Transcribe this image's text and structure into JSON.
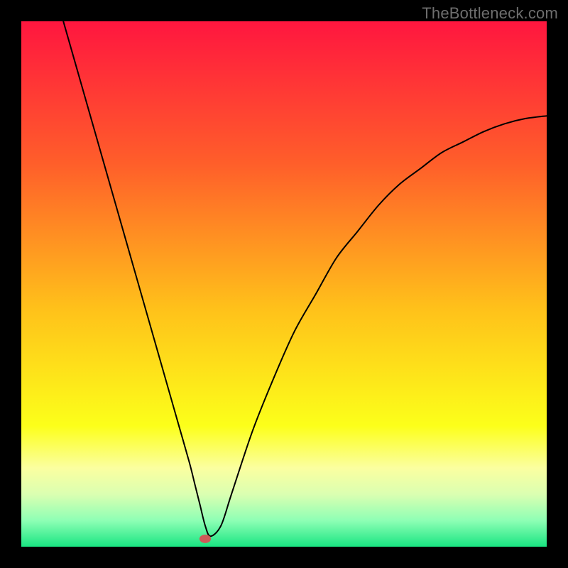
{
  "attribution": "TheBottleneck.com",
  "chart_data": {
    "type": "line",
    "title": "",
    "xlabel": "",
    "ylabel": "",
    "xlim": [
      0,
      100
    ],
    "ylim": [
      0,
      100
    ],
    "grid": false,
    "legend": false,
    "series": [
      {
        "name": "bottleneck-curve",
        "x": [
          8,
          12,
          16,
          20,
          24,
          28,
          30,
          32,
          33,
          34,
          35,
          36,
          38,
          40,
          44,
          48,
          52,
          56,
          60,
          64,
          68,
          72,
          76,
          80,
          84,
          88,
          92,
          96,
          100
        ],
        "y": [
          100,
          86,
          72,
          58,
          44,
          30,
          23,
          16,
          12,
          8,
          4,
          2,
          4,
          10,
          22,
          32,
          41,
          48,
          55,
          60,
          65,
          69,
          72,
          75,
          77,
          79,
          80.5,
          81.5,
          82
        ]
      }
    ],
    "marker": {
      "name": "optimal-point",
      "x": 35,
      "y": 1.5,
      "color": "#cf5a58"
    },
    "background_gradient": {
      "stops": [
        {
          "pos": 0.0,
          "color": "#ff163f"
        },
        {
          "pos": 0.27,
          "color": "#ff5e2a"
        },
        {
          "pos": 0.55,
          "color": "#ffc21a"
        },
        {
          "pos": 0.77,
          "color": "#fcff1a"
        },
        {
          "pos": 0.85,
          "color": "#fbffa0"
        },
        {
          "pos": 0.9,
          "color": "#dbffb1"
        },
        {
          "pos": 0.95,
          "color": "#8effb5"
        },
        {
          "pos": 1.0,
          "color": "#19e582"
        }
      ]
    }
  }
}
